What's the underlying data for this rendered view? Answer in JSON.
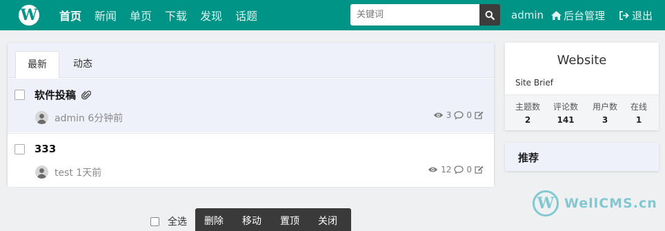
{
  "nav": {
    "logo": "W",
    "links": [
      "首页",
      "新闻",
      "单页",
      "下载",
      "发现",
      "话题"
    ],
    "search_placeholder": "关键词",
    "user": "admin",
    "admin_label": "后台管理",
    "logout_label": "退出"
  },
  "tabs": [
    "最新",
    "动态"
  ],
  "threads": [
    {
      "title": "软件投稿",
      "author": "admin",
      "time": "6分钟前",
      "views": "3",
      "comments": "0",
      "has_attachment": true
    },
    {
      "title": "333",
      "author": "test",
      "time": "1天前",
      "views": "12",
      "comments": "0",
      "has_attachment": false
    }
  ],
  "site": {
    "name": "Website",
    "brief": "Site Brief",
    "stats": [
      {
        "label": "主题数",
        "value": "2"
      },
      {
        "label": "评论数",
        "value": "141"
      },
      {
        "label": "用户数",
        "value": "3"
      },
      {
        "label": "在线",
        "value": "1"
      }
    ]
  },
  "recommend": {
    "title": "推荐"
  },
  "bulk": {
    "select_all": "全选",
    "actions": [
      "删除",
      "移动",
      "置顶",
      "关闭"
    ]
  },
  "watermark": {
    "text": "WellCMS.cn"
  },
  "colors": {
    "brand": "#009487",
    "search_button": "#3d3d3d",
    "toolbar": "#3a3a3a"
  }
}
